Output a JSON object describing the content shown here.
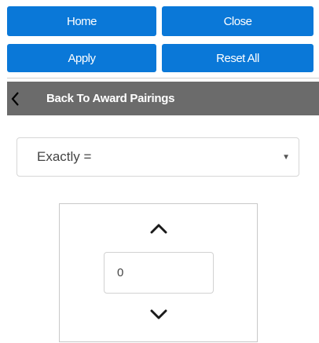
{
  "toolbar": {
    "home_label": "Home",
    "close_label": "Close",
    "apply_label": "Apply",
    "reset_label": "Reset All"
  },
  "back_bar": {
    "label": "Back To Award Pairings",
    "icon": "chevron-left-icon"
  },
  "filter": {
    "operator_selected": "Exactly ="
  },
  "spinner": {
    "value": "0",
    "up_icon": "chevron-up-icon",
    "down_icon": "chevron-down-icon"
  },
  "colors": {
    "button_blue": "#0a78d8",
    "back_bar_gray": "#6b6b6b"
  }
}
